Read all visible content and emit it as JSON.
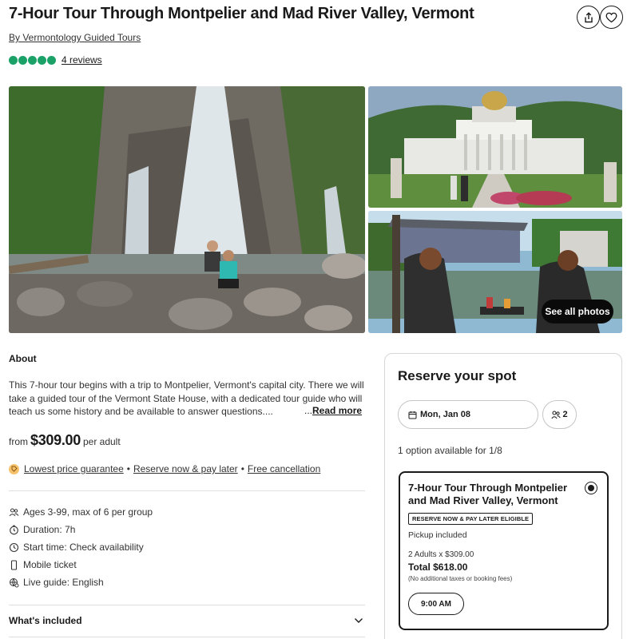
{
  "header": {
    "title": "7-Hour Tour Through Montpelier and Mad River Valley, Vermont",
    "operator_link": "By Vermontology Guided Tours",
    "rating_bubbles": 5,
    "reviews_link": "4 reviews",
    "share_icon": "share-icon",
    "save_icon": "heart-icon"
  },
  "gallery": {
    "see_all_label": "See all photos"
  },
  "about": {
    "heading": "About",
    "text": "This 7-hour tour begins with a trip to Montpelier, Vermont's capital city. There we will take a guided tour of the Vermont State House, with a dedicated tour guide who will teach us some history and be available to answer questions....",
    "ellipsis": "...",
    "read_more": "Read more"
  },
  "price": {
    "prefix": "from",
    "amount": "$309.00",
    "suffix": "per adult"
  },
  "features": {
    "lowest_price": "Lowest price guarantee",
    "sep1": "•",
    "reserve_later": "Reserve now & pay later",
    "sep2": "•",
    "free_cancel": "Free cancellation"
  },
  "details": [
    {
      "icon": "group-icon",
      "text": "Ages 3-99, max of 6 per group"
    },
    {
      "icon": "timer-icon",
      "text": "Duration: 7h"
    },
    {
      "icon": "clock-icon",
      "text": "Start time: Check availability"
    },
    {
      "icon": "phone-icon",
      "text": "Mobile ticket"
    },
    {
      "icon": "globe-icon",
      "text": "Live guide: English"
    }
  ],
  "whats_included": "What's included",
  "reserve": {
    "heading": "Reserve your spot",
    "date": "Mon, Jan 08",
    "guests": "2",
    "options_available": "1 option available for 1/8",
    "option": {
      "title": "7-Hour Tour Through Montpelier and Mad River Valley, Vermont",
      "badge": "RESERVE NOW & PAY LATER ELIGIBLE",
      "pickup": "Pickup included",
      "adults": "2 Adults x $309.00",
      "total": "Total $618.00",
      "fees": "(No additional taxes or booking fees)",
      "time": "9:00 AM"
    }
  },
  "colors": {
    "rating_green": "#1aa167",
    "text": "#1a1a1a",
    "border": "#d7d7d7"
  }
}
